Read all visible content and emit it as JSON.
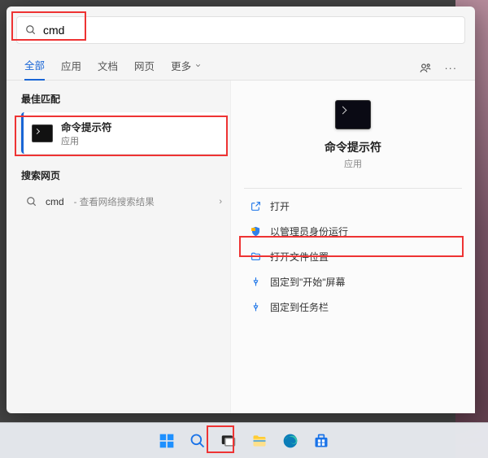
{
  "search": {
    "query": "cmd",
    "placeholder": ""
  },
  "tabs": {
    "all": "全部",
    "apps": "应用",
    "docs": "文档",
    "web": "网页",
    "more": "更多"
  },
  "left": {
    "best_match_header": "最佳匹配",
    "best_match": {
      "title": "命令提示符",
      "subtitle": "应用"
    },
    "search_web_header": "搜索网页",
    "web_result": {
      "term": "cmd",
      "suffix": " - 查看网络搜索结果"
    }
  },
  "detail": {
    "title": "命令提示符",
    "subtitle": "应用",
    "actions": {
      "open": "打开",
      "run_admin": "以管理员身份运行",
      "open_location": "打开文件位置",
      "pin_start": "固定到\"开始\"屏幕",
      "pin_taskbar": "固定到任务栏"
    }
  }
}
